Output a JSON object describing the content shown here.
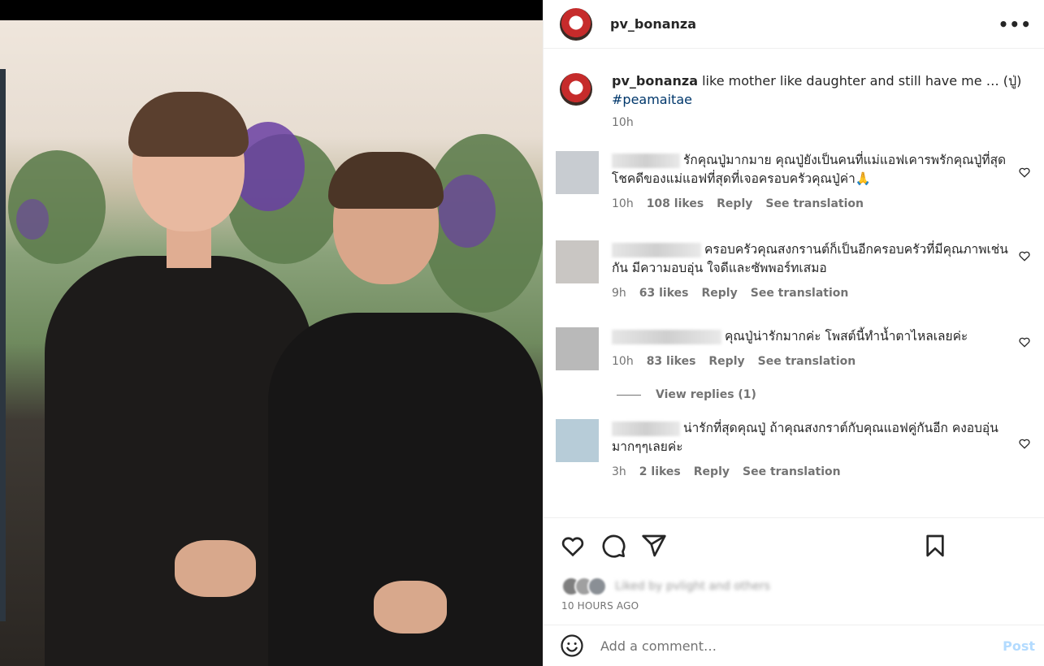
{
  "header": {
    "username": "pv_bonanza",
    "more_icon": "more-horizontal-icon",
    "more_label": "•••"
  },
  "caption": {
    "username": "pv_bonanza",
    "text": " like mother like daughter and still have me … (ปู่)",
    "hashtag": "#peamaitae",
    "time": "10h"
  },
  "comments": [
    {
      "text": "รักคุณปู่มากมาย คุณปู่ยังเป็นคนที่แม่แอฟเคารพรักคุณปู่ที่สุด โชคดีของแม่แอฟที่สุดที่เจอครอบครัวคุณปู่ค่า🙏",
      "time": "10h",
      "likes": "108 likes",
      "reply": "Reply",
      "translate": "See translation"
    },
    {
      "text": "ครอบครัวคุณสงกรานต์ก็เป็นอีกครอบครัวที่มีคุณภาพเช่นกัน มีความอบอุ่น ใจดีและซัพพอร์ทเสมอ",
      "time": "9h",
      "likes": "63 likes",
      "reply": "Reply",
      "translate": "See translation"
    },
    {
      "text": "คุณปู่น่ารักมากค่ะ โพสต์นี้ทำน้ำตาไหลเลยค่ะ",
      "time": "10h",
      "likes": "83 likes",
      "reply": "Reply",
      "translate": "See translation"
    },
    {
      "text": "น่ารักที่สุดคุณปู่ ถ้าคุณสงกราต์กับคุณแอฟคู่กันอีก คงอบอุ่นมากๆๆเลยค่ะ",
      "time": "3h",
      "likes": "2 likes",
      "reply": "Reply",
      "translate": "See translation"
    }
  ],
  "view_replies": "View replies (1)",
  "actions": {
    "like_icon": "heart-icon",
    "comment_icon": "comment-icon",
    "share_icon": "share-icon",
    "save_icon": "bookmark-icon"
  },
  "liked_by": "Liked by pvlight and others",
  "timestamp": "10 HOURS AGO",
  "comment_box": {
    "placeholder": "Add a comment…",
    "post_label": "Post"
  },
  "colors": {
    "hashtag": "#00376b",
    "secondary_text": "#737373",
    "post_disabled": "#b3dbff"
  }
}
